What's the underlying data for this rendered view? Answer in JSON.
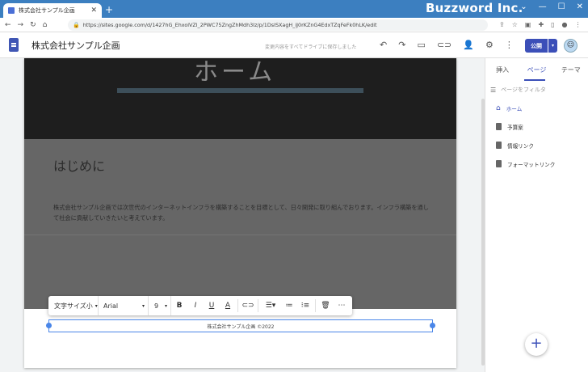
{
  "browser": {
    "tab_title": "株式会社サンプル企画",
    "watermark": "Buzzword Inc.",
    "url": "https://sites.google.com/d/1427hG_EhxolVZl_2PWC75ZngZhMdh3Iz/p/1DsISXagH_iJ0rKZnG4EdxTZqFeFk0hLK/edit"
  },
  "app": {
    "site_name": "株式会社サンプル企画",
    "saved_status": "変更内容をすべてドライブに保存しました",
    "publish_label": "公開"
  },
  "hero": {
    "title": "ホーム"
  },
  "section": {
    "heading": "はじめに",
    "body": "株式会社サンプル企画では次世代のインターネットインフラを構築することを目標として、日々開発に取り組んでおります。インフラ構築を通して社会に貢献していきたいと考えています。"
  },
  "toolbar": {
    "size_label": "文字サイズ小",
    "font": "Arial",
    "font_size": "9"
  },
  "footer": {
    "text": "株式会社サンプル企画 ©2022"
  },
  "side": {
    "tabs": [
      "挿入",
      "ページ",
      "テーマ"
    ],
    "filter_placeholder": "ページをフィルタ",
    "pages": [
      "ホーム",
      "予算案",
      "情報リンク",
      "フォーマットリンク"
    ]
  },
  "colors": {
    "accent": "#3b4fb8",
    "titlebar": "#3c7fc0"
  }
}
